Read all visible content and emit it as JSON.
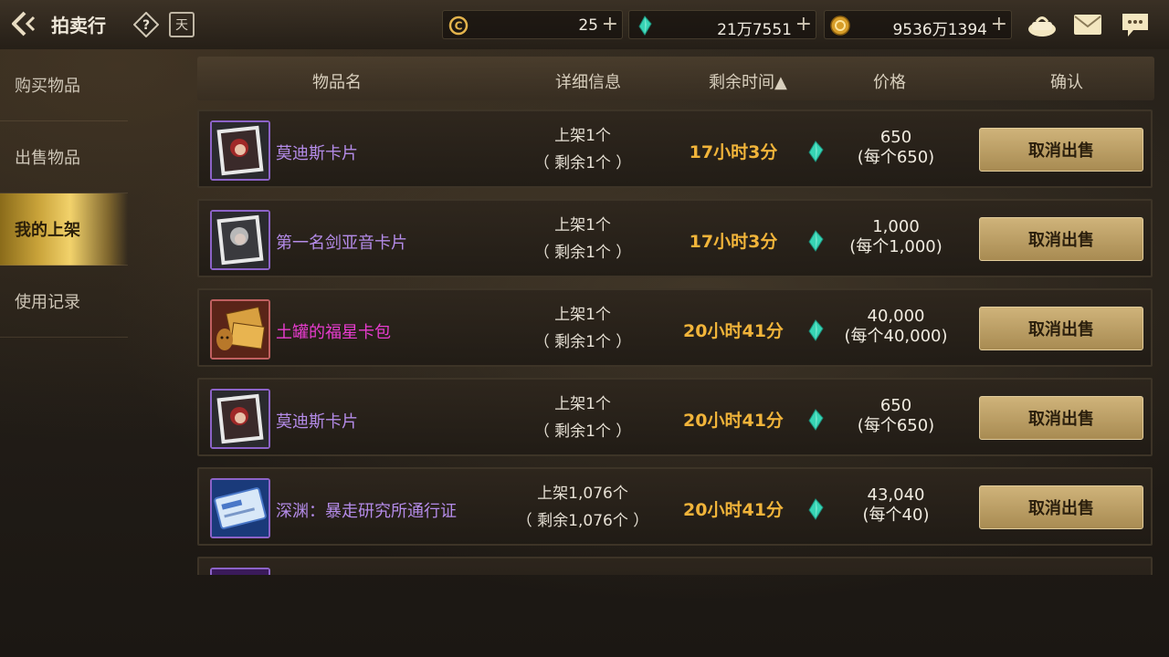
{
  "header": {
    "title": "拍卖行",
    "calendar_label": "天"
  },
  "currencies": [
    {
      "icon": "coin-c-icon",
      "value": "25"
    },
    {
      "icon": "gem-icon",
      "value": "21万7551"
    },
    {
      "icon": "gold-coin-icon",
      "value": "9536万1394"
    }
  ],
  "sidebar": {
    "items": [
      {
        "label": "购买物品"
      },
      {
        "label": "出售物品"
      },
      {
        "label": "我的上架"
      },
      {
        "label": "使用记录"
      }
    ],
    "active": "我的上架"
  },
  "table": {
    "columns": [
      "物品名",
      "详细信息",
      "剩余时间▲",
      "价格",
      "确认"
    ],
    "rows": [
      {
        "name": "莫迪斯卡片",
        "name_color": "purple",
        "listed": "上架1个",
        "remaining": "（ 剩余1个 ）",
        "time": "17小时3分",
        "price": "650",
        "unit_price": "(每个650)",
        "button": "取消出售"
      },
      {
        "name": "第一名剑亚音卡片",
        "name_color": "purple",
        "listed": "上架1个",
        "remaining": "（ 剩余1个 ）",
        "time": "17小时3分",
        "price": "1,000",
        "unit_price": "(每个1,000)",
        "button": "取消出售"
      },
      {
        "name": "土罐的福星卡包",
        "name_color": "pink",
        "listed": "上架1个",
        "remaining": "（ 剩余1个 ）",
        "time": "20小时41分",
        "price": "40,000",
        "unit_price": "(每个40,000)",
        "button": "取消出售"
      },
      {
        "name": "莫迪斯卡片",
        "name_color": "purple",
        "listed": "上架1个",
        "remaining": "（ 剩余1个 ）",
        "time": "20小时41分",
        "price": "650",
        "unit_price": "(每个650)",
        "button": "取消出售"
      },
      {
        "name": "深渊：暴走研究所通行证",
        "name_color": "purple",
        "listed": "上架1,076个",
        "remaining": "（ 剩余1,076个 ）",
        "time": "20小时41分",
        "price": "43,040",
        "unit_price": "(每个40)",
        "button": "取消出售"
      }
    ]
  },
  "colors": {
    "accent_gold": "#f1b43a",
    "item_purple": "#b48be8",
    "item_pink": "#e83ccf",
    "button_gold": "#cfb37a"
  }
}
